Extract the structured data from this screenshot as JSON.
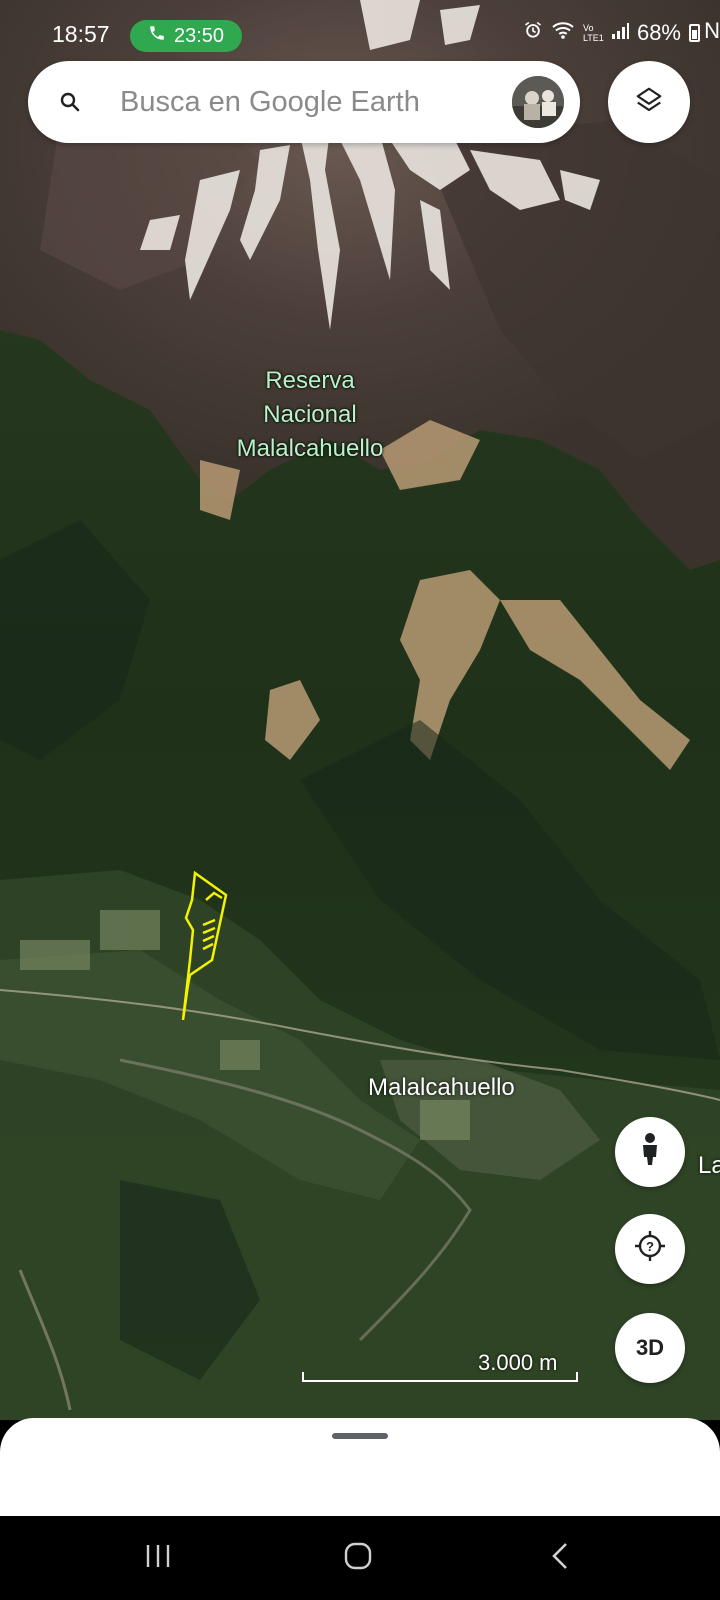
{
  "status_bar": {
    "time": "18:57",
    "call_timer": "23:50",
    "network": "Vo LTE1",
    "battery": "68%",
    "overflow": "N"
  },
  "search": {
    "placeholder": "Busca en Google Earth"
  },
  "map": {
    "labels": {
      "reserve_line1": "Reserva",
      "reserve_line2": "Nacional",
      "reserve_line3": "Malalcahuello",
      "town": "Malalcahuello",
      "edge_label": "La"
    },
    "scale_text": "3.000 m",
    "polygon_color": "#f3f200"
  },
  "buttons": {
    "three_d": "3D"
  },
  "icons": {
    "search": "search-icon",
    "layers": "layers-icon",
    "pegman": "pegman-icon",
    "locate": "my-location-icon",
    "phone": "phone-icon"
  }
}
